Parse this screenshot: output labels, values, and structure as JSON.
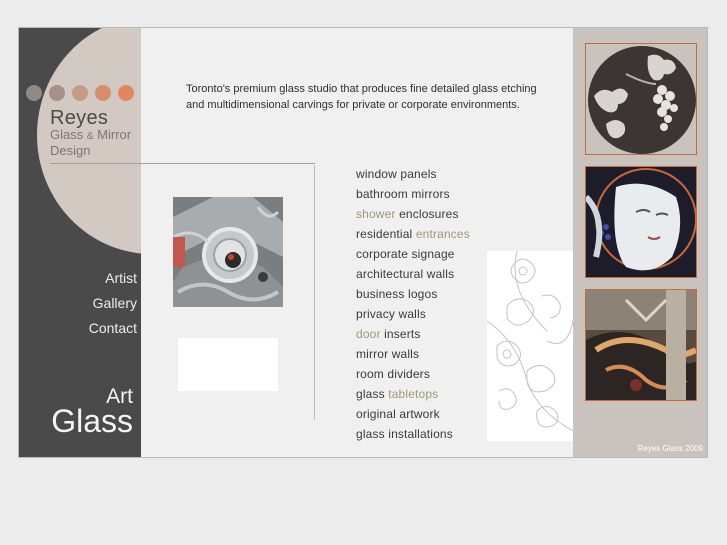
{
  "brand": {
    "name": "Reyes",
    "sub_line1_a": "Glass",
    "sub_amp": "&",
    "sub_line1_b": "Mirror",
    "sub_line2": "Design",
    "art": "Art",
    "glass": "Glass",
    "dot_colors": [
      "#8f8a87",
      "#a8908a",
      "#c79a86",
      "#d78e6e",
      "#e0875f"
    ]
  },
  "nav": {
    "items": [
      "Artist",
      "Gallery",
      "Contact"
    ]
  },
  "tagline": "Toronto's premium glass studio that produces fine detailed glass etching and multidimensional carvings for private or corporate environments.",
  "services": [
    {
      "pre": "",
      "hl": "",
      "post": "window panels"
    },
    {
      "pre": "",
      "hl": "",
      "post": "bathroom mirrors"
    },
    {
      "pre": "",
      "hl": "shower",
      "post": " enclosures"
    },
    {
      "pre": "residential ",
      "hl": "entrances",
      "post": ""
    },
    {
      "pre": "",
      "hl": "",
      "post": "corporate signage"
    },
    {
      "pre": "",
      "hl": "",
      "post": "architectural walls"
    },
    {
      "pre": "",
      "hl": "",
      "post": "business logos"
    },
    {
      "pre": "",
      "hl": "",
      "post": "privacy walls"
    },
    {
      "pre": "",
      "hl": "door",
      "post": " inserts"
    },
    {
      "pre": "",
      "hl": "",
      "post": "mirror walls"
    },
    {
      "pre": "",
      "hl": "",
      "post": "room dividers"
    },
    {
      "pre": "glass ",
      "hl": "tabletops",
      "post": ""
    },
    {
      "pre": "",
      "hl": "",
      "post": "original artwork"
    },
    {
      "pre": "",
      "hl": "",
      "post": "glass installations"
    }
  ],
  "footer": {
    "copyright": "Reyes Glass 2009"
  },
  "colors": {
    "accent": "#c8693a",
    "highlight": "#9c9a73",
    "sidebar": "#4a4a4a"
  }
}
